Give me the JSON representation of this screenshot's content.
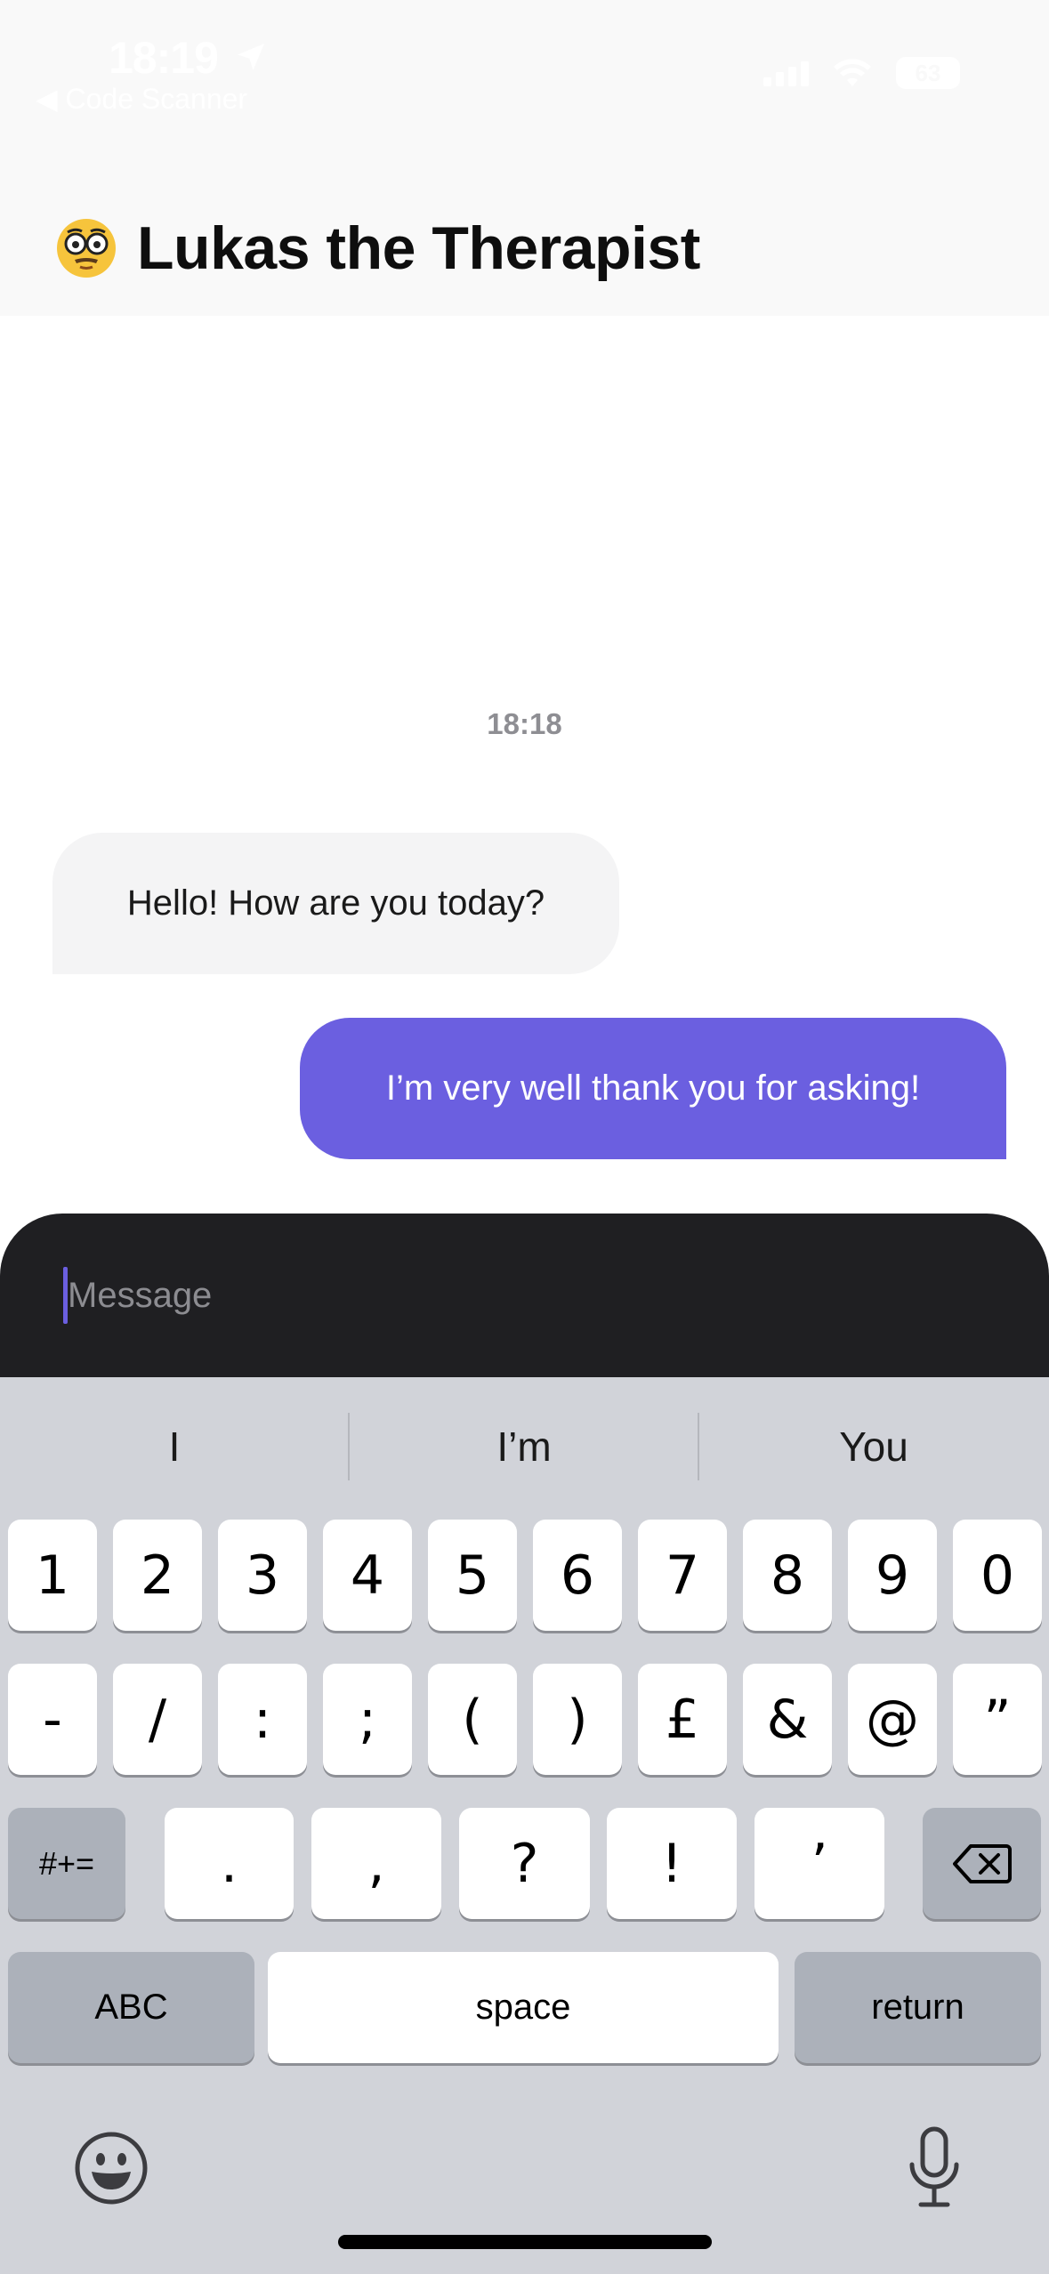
{
  "status_bar": {
    "time": "18:19",
    "back_label": "◀ Code Scanner",
    "battery": "63"
  },
  "header": {
    "emoji_icon": "nerd-glasses-face-icon",
    "title": "Lukas the Therapist"
  },
  "conversation": {
    "timestamp": "18:18",
    "messages": [
      {
        "sender": "bot",
        "text": "Hello! How are you today?"
      },
      {
        "sender": "user",
        "text": "I’m very well thank you for asking!"
      }
    ]
  },
  "composer": {
    "placeholder": "Message",
    "value": ""
  },
  "keyboard": {
    "suggestions": [
      "I",
      "I’m",
      "You"
    ],
    "row1": [
      "1",
      "2",
      "3",
      "4",
      "5",
      "6",
      "7",
      "8",
      "9",
      "0"
    ],
    "row2": [
      "-",
      "/",
      ":",
      ";",
      "(",
      ")",
      "£",
      "&",
      "@",
      "”"
    ],
    "row3_mode": "#+=",
    "row3": [
      ".",
      ",",
      "?",
      "!",
      "’"
    ],
    "abc_label": "ABC",
    "space_label": "space",
    "return_label": "return",
    "delete_icon": "backspace-icon",
    "emoji_icon": "emoji-smile-icon",
    "mic_icon": "microphone-icon"
  },
  "colors": {
    "accent": "#6b5fe0",
    "bot_bubble": "#f4f4f5",
    "composer_bg": "#1f1f22",
    "keyboard_bg": "#d1d3d9"
  }
}
